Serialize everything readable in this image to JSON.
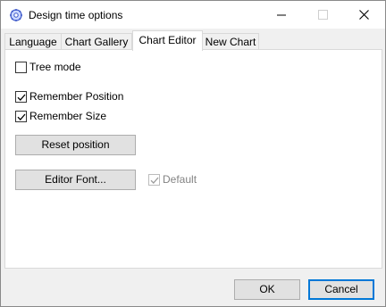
{
  "window": {
    "title": "Design time options",
    "icon": "gear-icon"
  },
  "titlebar_buttons": [
    "minimize",
    "maximize",
    "close"
  ],
  "tabs": [
    {
      "label": "Language",
      "active": false
    },
    {
      "label": "Chart Gallery",
      "active": false
    },
    {
      "label": "Chart Editor",
      "active": true
    },
    {
      "label": "New Chart",
      "active": false
    }
  ],
  "options": {
    "tree_mode": {
      "label": "Tree mode",
      "checked": false
    },
    "remember_position": {
      "label": "Remember Position",
      "checked": true
    },
    "remember_size": {
      "label": "Remember Size",
      "checked": true
    },
    "reset_position_label": "Reset position",
    "editor_font_label": "Editor Font...",
    "default_font": {
      "label": "Default",
      "checked": true,
      "enabled": false
    }
  },
  "footer": {
    "ok_label": "OK",
    "cancel_label": "Cancel"
  }
}
